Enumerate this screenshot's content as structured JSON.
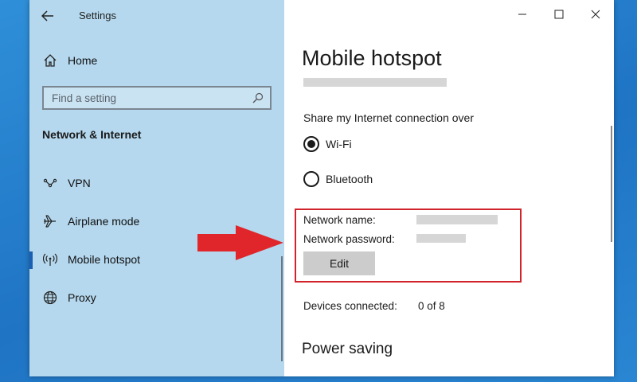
{
  "window": {
    "title": "Settings"
  },
  "sidebar": {
    "home_label": "Home",
    "search_placeholder": "Find a setting",
    "section_heading": "Network & Internet",
    "items": [
      {
        "label": "VPN",
        "icon": "vpn-icon"
      },
      {
        "label": "Airplane mode",
        "icon": "airplane-icon"
      },
      {
        "label": "Mobile hotspot",
        "icon": "hotspot-icon",
        "selected": true
      },
      {
        "label": "Proxy",
        "icon": "globe-icon"
      }
    ]
  },
  "content": {
    "page_title": "Mobile hotspot",
    "share_label": "Share my Internet connection over",
    "options": [
      {
        "label": "Wi-Fi",
        "checked": true
      },
      {
        "label": "Bluetooth",
        "checked": false
      }
    ],
    "network_name_label": "Network name:",
    "network_password_label": "Network password:",
    "edit_label": "Edit",
    "devices_label": "Devices connected:",
    "devices_value": "0 of 8",
    "power_saving_heading": "Power saving"
  },
  "colors": {
    "sidebar_bg": "#b5d8ee",
    "highlight_box": "#d1232a",
    "arrow": "#e0262b",
    "accent": "#1a5fb4"
  }
}
